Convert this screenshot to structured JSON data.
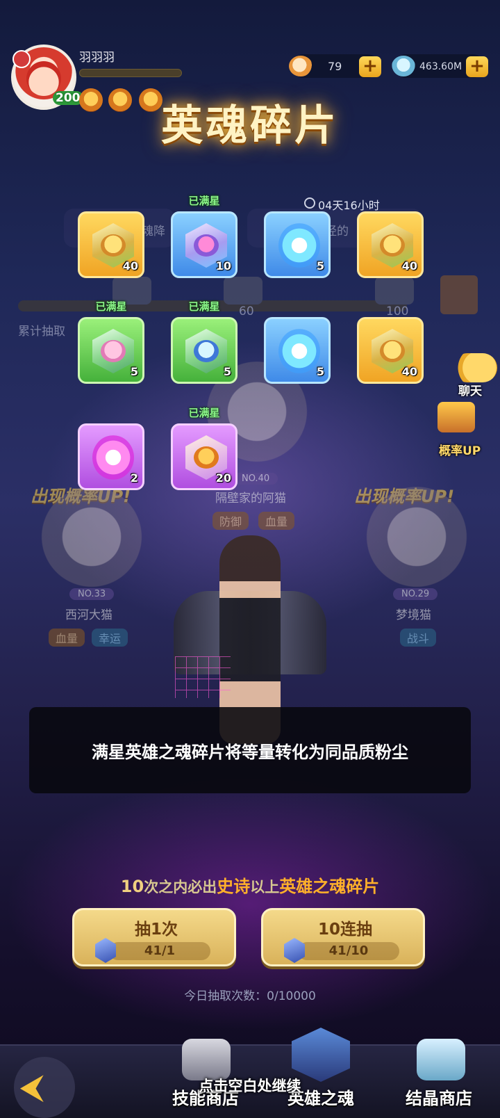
{
  "player": {
    "name": "羽羽羽",
    "level": "200",
    "exp_fraction": 0.0
  },
  "resources": [
    {
      "icon": "shell-icon",
      "value": "79"
    },
    {
      "icon": "crystal-icon",
      "value": "463.60M"
    }
  ],
  "title": "英魂碎片",
  "background": {
    "timer": "04天16小时",
    "banner_left": "魂降",
    "banner_right": "经的",
    "progress_label": "累计抽取",
    "milestones": [
      "60",
      "100"
    ],
    "center_hero": {
      "no": "NO.40",
      "name": "隔壁家的阿猫",
      "tags": [
        "防御",
        "血量"
      ]
    },
    "left_hero": {
      "up_text": "出现概率UP!",
      "no": "NO.33",
      "name": "西河大猫",
      "tags": [
        "血量",
        "幸运"
      ]
    },
    "right_hero": {
      "up_text": "出现概率UP!",
      "no": "NO.29",
      "name": "梦境猫",
      "tags": [
        "战斗"
      ]
    }
  },
  "side_buttons": {
    "chat": "聊天",
    "rate_up": "概率UP"
  },
  "rewards": [
    {
      "quality": "gold",
      "count": "40",
      "star_label": ""
    },
    {
      "quality": "blue",
      "count": "10",
      "star_label": "已满星"
    },
    {
      "quality": "blue-spirit",
      "count": "5",
      "star_label": ""
    },
    {
      "quality": "gold",
      "count": "40",
      "star_label": ""
    },
    {
      "quality": "green",
      "count": "5",
      "star_label": "已满星"
    },
    {
      "quality": "green-alt",
      "count": "5",
      "star_label": "已满星"
    },
    {
      "quality": "blue-spirit",
      "count": "5",
      "star_label": ""
    },
    {
      "quality": "gold",
      "count": "40",
      "star_label": ""
    },
    {
      "quality": "purple",
      "count": "2",
      "star_label": ""
    },
    {
      "quality": "purple-tiger",
      "count": "20",
      "star_label": "已满星"
    }
  ],
  "toast": "满星英雄之魂碎片将等量转化为同品质粉尘",
  "guarantee": {
    "part1": "10",
    "part2": "次之内必出",
    "part3": "史诗",
    "part4": "以上",
    "part5": "英雄之魂碎片"
  },
  "draw_buttons": [
    {
      "label": "抽1次",
      "cost": "41/1"
    },
    {
      "label": "10连抽",
      "cost": "41/10"
    }
  ],
  "today_count": "今日抽取次数：0/10000",
  "nav": {
    "skill_shop": "技能商店",
    "hero_soul": "英雄之魂",
    "crystal_shop": "结晶商店"
  },
  "continue_hint": "点击空白处继续",
  "colors": {
    "gold_quality": "#f0a424",
    "blue_quality": "#3f8ae8",
    "green_quality": "#45b13b",
    "purple_quality": "#b04ee0",
    "star_label": "#8cf58a"
  }
}
